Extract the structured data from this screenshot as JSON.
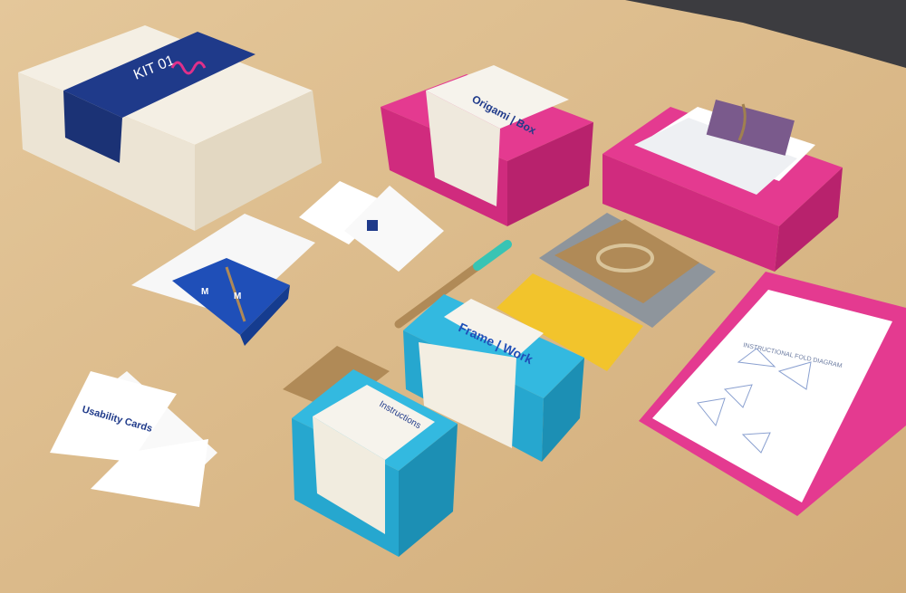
{
  "scene": {
    "kit_box_label": "KIT 01",
    "origami_box_title": "Origami | Box",
    "framework_box_title": "Frame | Work",
    "instructions_heading": "Instructions",
    "usability_cards_title": "Usability Cards",
    "diagram_header": "INSTRUCTIONAL FOLD DIAGRAM"
  },
  "colors": {
    "table": "#d9b98a",
    "kit_band": "#1f3a8a",
    "magenta_box": "#e0308a",
    "cyan_box": "#26aed6",
    "yellow_card": "#f2c42c",
    "kraft": "#b08a57",
    "blue_booklet": "#1f4fb8"
  }
}
